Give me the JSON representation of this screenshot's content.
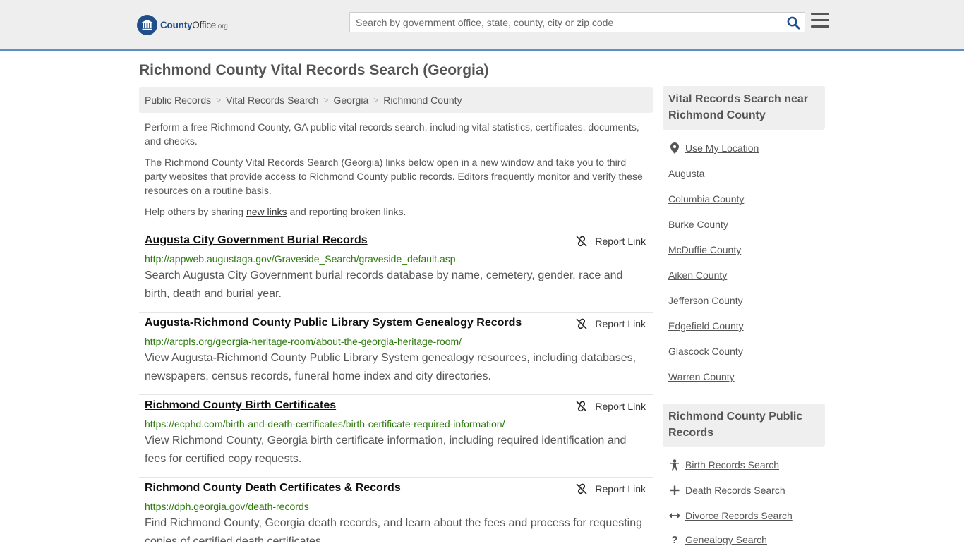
{
  "header": {
    "logo_brand": "County",
    "logo_rest": "Office",
    "logo_tld": ".org",
    "search_placeholder": "Search by government office, state, county, city or zip code"
  },
  "page_title": "Richmond County Vital Records Search (Georgia)",
  "breadcrumb": [
    "Public Records",
    "Vital Records Search",
    "Georgia",
    "Richmond County"
  ],
  "intro": {
    "p1": "Perform a free Richmond County, GA public vital records search, including vital statistics, certificates, documents, and checks.",
    "p2": "The Richmond County Vital Records Search (Georgia) links below open in a new window and take you to third party websites that provide access to Richmond County public records. Editors frequently monitor and verify these resources on a routine basis.",
    "p3_before": "Help others by sharing ",
    "p3_link": "new links",
    "p3_after": " and reporting broken links."
  },
  "report_label": "Report Link",
  "listings": [
    {
      "title": "Augusta City Government Burial Records",
      "url": "http://appweb.augustaga.gov/Graveside_Search/graveside_default.asp",
      "desc": "Search Augusta City Government burial records database by name, cemetery, gender, race and birth, death and burial year."
    },
    {
      "title": "Augusta-Richmond County Public Library System Genealogy Records",
      "url": "http://arcpls.org/georgia-heritage-room/about-the-georgia-heritage-room/",
      "desc": "View Augusta-Richmond County Public Library System genealogy resources, including databases, newspapers, census records, funeral home index and city directories."
    },
    {
      "title": "Richmond County Birth Certificates",
      "url": "https://ecphd.com/birth-and-death-certificates/birth-certificate-required-information/",
      "desc": "View Richmond County, Georgia birth certificate information, including required identification and fees for certified copy requests."
    },
    {
      "title": "Richmond County Death Certificates & Records",
      "url": "https://dph.georgia.gov/death-records",
      "desc": "Find Richmond County, Georgia death records, and learn about the fees and process for requesting copies of certified death certificates."
    }
  ],
  "sidebar": {
    "nearby_heading": "Vital Records Search near Richmond County",
    "use_location": "Use My Location",
    "nearby": [
      "Augusta",
      "Columbia County",
      "Burke County",
      "McDuffie County",
      "Aiken County",
      "Jefferson County",
      "Edgefield County",
      "Glascock County",
      "Warren County"
    ],
    "public_heading": "Richmond County Public Records",
    "public_links": [
      {
        "label": "Birth Records Search",
        "icon": "baby-icon"
      },
      {
        "label": "Death Records Search",
        "icon": "cross-icon"
      },
      {
        "label": "Divorce Records Search",
        "icon": "arrows-horizontal-icon"
      },
      {
        "label": "Genealogy Search",
        "icon": "question-icon"
      }
    ]
  },
  "colors": {
    "accent_border": "#5b8fc7",
    "logo_blue": "#1f4e89",
    "url_green": "#2b7a0b"
  }
}
